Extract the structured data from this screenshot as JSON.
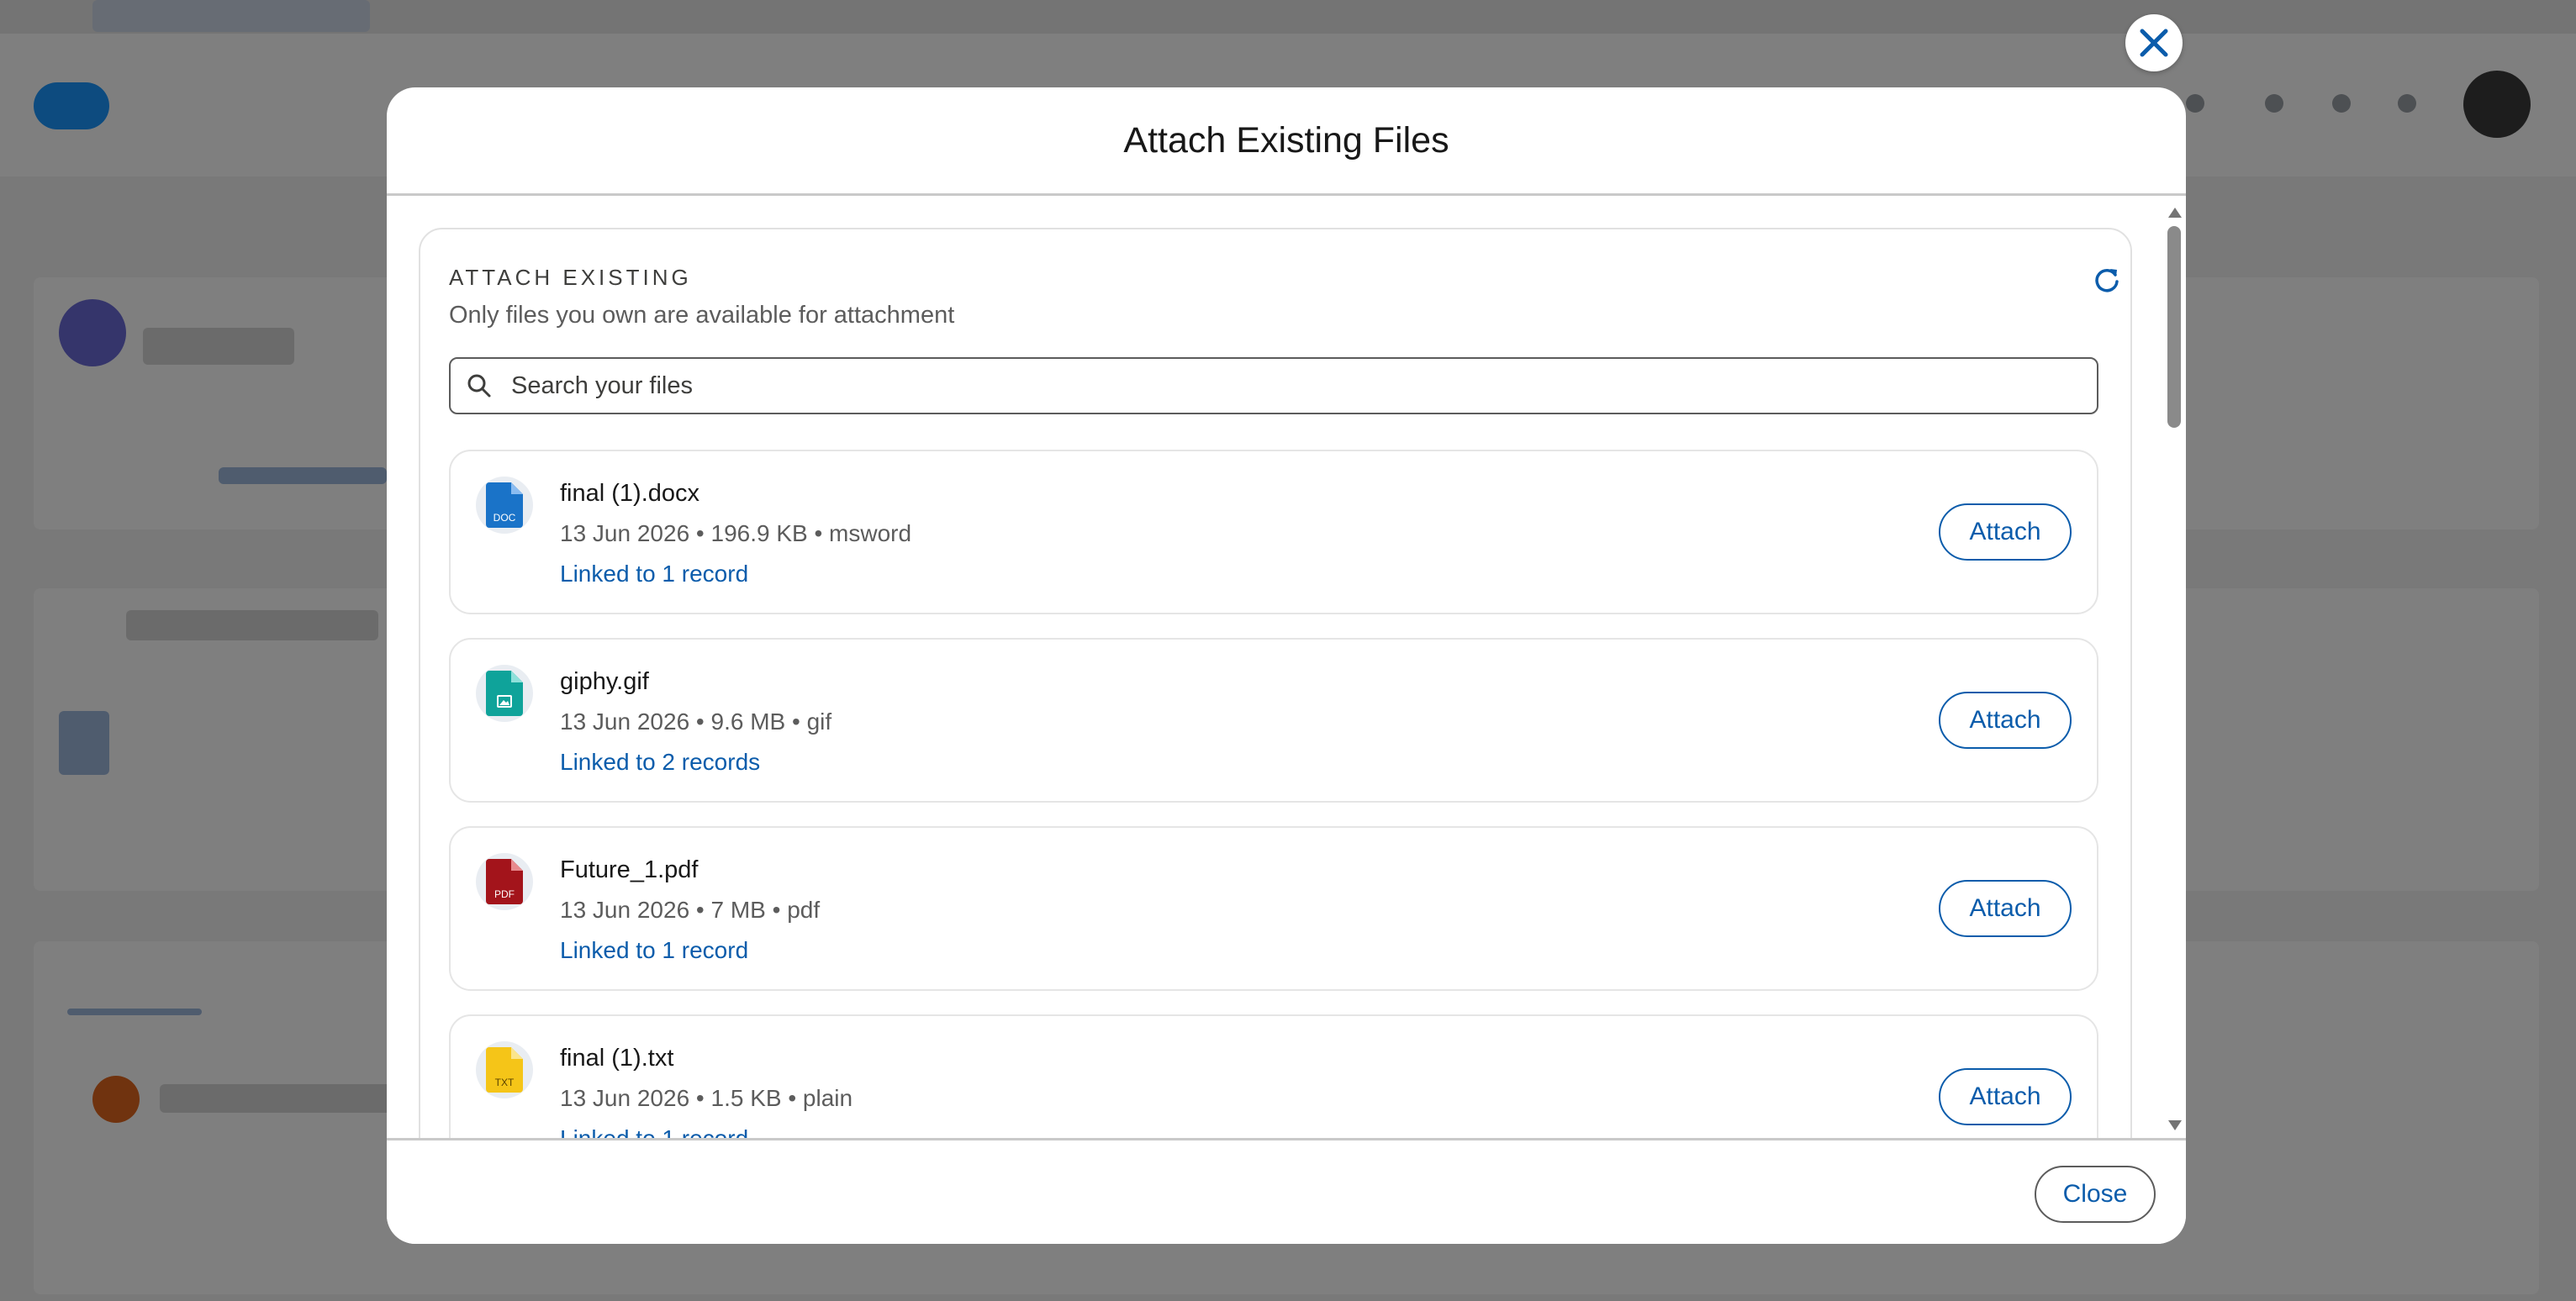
{
  "modal": {
    "title": "Attach Existing Files",
    "close_label": "Close"
  },
  "attach_section": {
    "heading": "ATTACH EXISTING",
    "subtitle": "Only files you own are available for attachment",
    "search_placeholder": "Search your files",
    "search_value": ""
  },
  "files": [
    {
      "name": "final (1).docx",
      "meta": "13 Jun 2026 • 196.9 KB • msword",
      "link": "Linked to 1 record",
      "attach_label": "Attach",
      "icon": "doc-file-icon",
      "icon_text": "DOC",
      "color": "#1a73c8"
    },
    {
      "name": "giphy.gif",
      "meta": "13 Jun 2026 • 9.6 MB • gif",
      "link": "Linked to 2 records",
      "attach_label": "Attach",
      "icon": "image-file-icon",
      "icon_text": "",
      "color": "#0fa39a"
    },
    {
      "name": "Future_1.pdf",
      "meta": "13 Jun 2026 • 7 MB • pdf",
      "link": "Linked to 1 record",
      "attach_label": "Attach",
      "icon": "pdf-file-icon",
      "icon_text": "PDF",
      "color": "#a3141b"
    },
    {
      "name": "final (1).txt",
      "meta": "13 Jun 2026 • 1.5 KB • plain",
      "link": "Linked to 1 record",
      "attach_label": "Attach",
      "icon": "txt-file-icon",
      "icon_text": "TXT",
      "color": "#f5c518"
    }
  ],
  "colors": {
    "accent": "#0b5cab",
    "overlay": "rgba(0,0,0,0.5)"
  }
}
